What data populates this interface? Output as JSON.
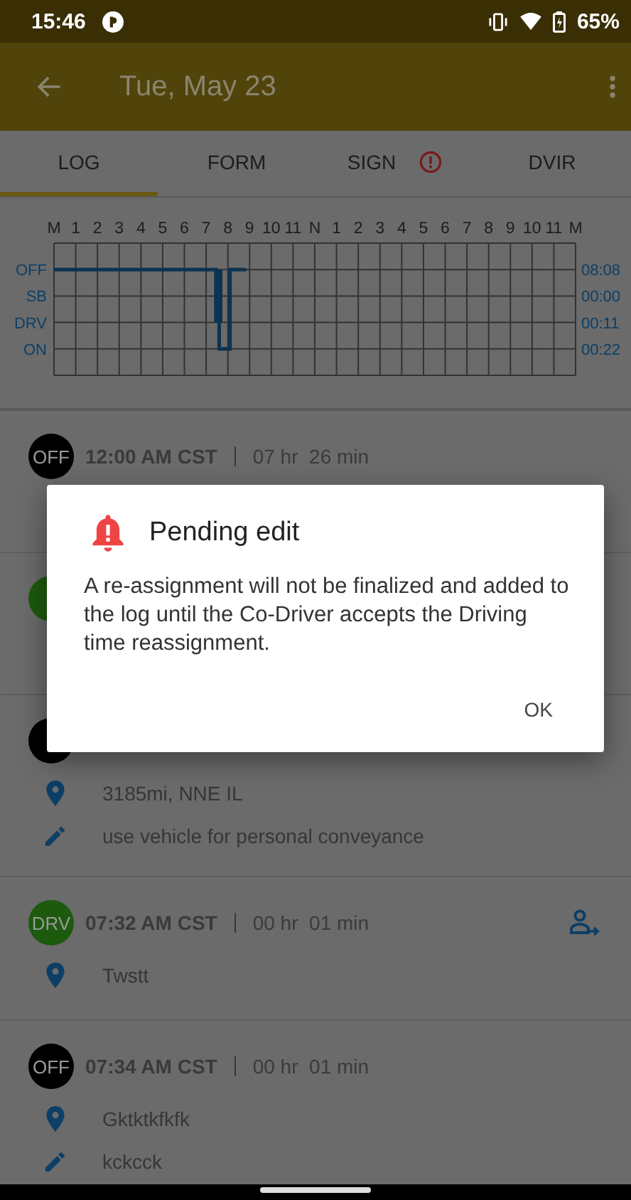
{
  "status_bar": {
    "time": "15:46",
    "battery": "65%"
  },
  "app_bar": {
    "title": "Tue, May 23"
  },
  "tabs": [
    {
      "label": "LOG",
      "selected": true,
      "alert": false
    },
    {
      "label": "FORM",
      "selected": false,
      "alert": false
    },
    {
      "label": "SIGN",
      "selected": false,
      "alert": true
    },
    {
      "label": "DVIR",
      "selected": false,
      "alert": false
    }
  ],
  "log_chart": {
    "hours": [
      "M",
      "1",
      "2",
      "3",
      "4",
      "5",
      "6",
      "7",
      "8",
      "9",
      "10",
      "11",
      "N",
      "1",
      "2",
      "3",
      "4",
      "5",
      "6",
      "7",
      "8",
      "9",
      "10",
      "11",
      "M"
    ],
    "rows": [
      {
        "label": "OFF",
        "total": "08:08"
      },
      {
        "label": "SB",
        "total": "00:00"
      },
      {
        "label": "DRV",
        "total": "00:11"
      },
      {
        "label": "ON",
        "total": "00:22"
      }
    ]
  },
  "entries": [
    {
      "badge": "OFF",
      "color": "#000000",
      "time": "12:00 AM CST",
      "duration": "07 hr  26 min"
    },
    {
      "color": "#1d5a0e"
    },
    {
      "color": "#000000",
      "location": "3185mi, NNE IL",
      "note": "use vehicle for personal conveyance"
    },
    {
      "badge": "DRV",
      "color": "#1d5a0e",
      "time": "07:32 AM CST",
      "duration": "00 hr  01 min",
      "location": "Twstt",
      "reassign": true
    },
    {
      "badge": "OFF",
      "color": "#000000",
      "time": "07:34 AM CST",
      "duration": "00 hr  01 min",
      "location": "Gktktkfkfk",
      "note": "kckcck"
    }
  ],
  "dialog": {
    "title": "Pending edit",
    "message": "A re-assignment will not be finalized and added to the log until the Co-Driver accepts the Driving time reassignment.",
    "button": "OK"
  }
}
